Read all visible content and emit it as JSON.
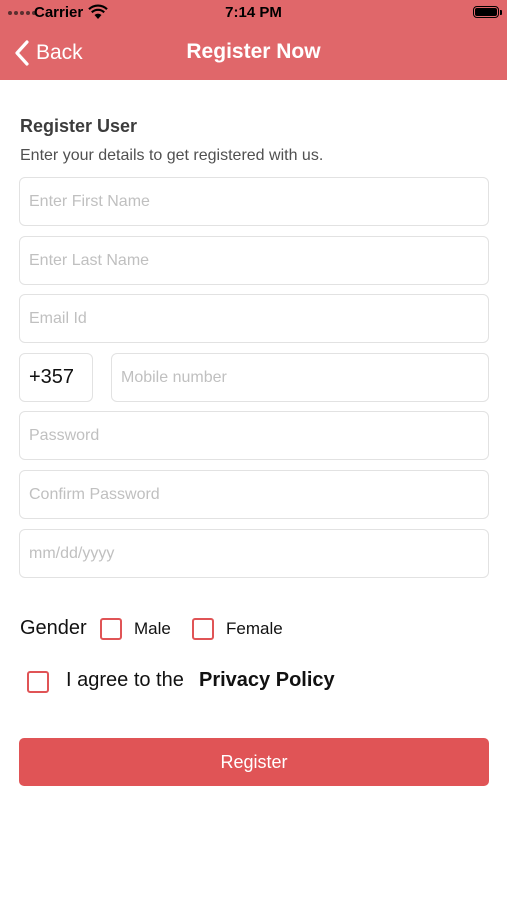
{
  "status_bar": {
    "carrier": "Carrier",
    "time": "7:14 PM",
    "icons": [
      "signal-dots-icon",
      "wifi-icon",
      "battery-icon"
    ]
  },
  "nav": {
    "back_label": "Back",
    "back_icon": "chevron-left-icon",
    "title": "Register Now"
  },
  "form": {
    "heading": "Register User",
    "subheading": "Enter your details to get registered with us.",
    "first_name": {
      "value": "",
      "placeholder": "Enter First Name"
    },
    "last_name": {
      "value": "",
      "placeholder": "Enter Last Name"
    },
    "email": {
      "value": "",
      "placeholder": "Email Id"
    },
    "country_code": "+357",
    "mobile": {
      "value": "",
      "placeholder": "Mobile number"
    },
    "password": {
      "value": "",
      "placeholder": "Password"
    },
    "confirm_password": {
      "value": "",
      "placeholder": "Confirm Password"
    },
    "dob": {
      "value": "",
      "placeholder": "mm/dd/yyyy"
    },
    "gender_label": "Gender",
    "gender_options": [
      {
        "label": "Male",
        "checked": false
      },
      {
        "label": "Female",
        "checked": false
      }
    ],
    "agree_text": "I agree to the",
    "policy_link": "Privacy Policy",
    "agree_checked": false,
    "submit_label": "Register"
  },
  "colors": {
    "header": "#e0676a",
    "accent": "#e05456",
    "border": "#e2e2e2",
    "placeholder": "#c0c0c0"
  }
}
